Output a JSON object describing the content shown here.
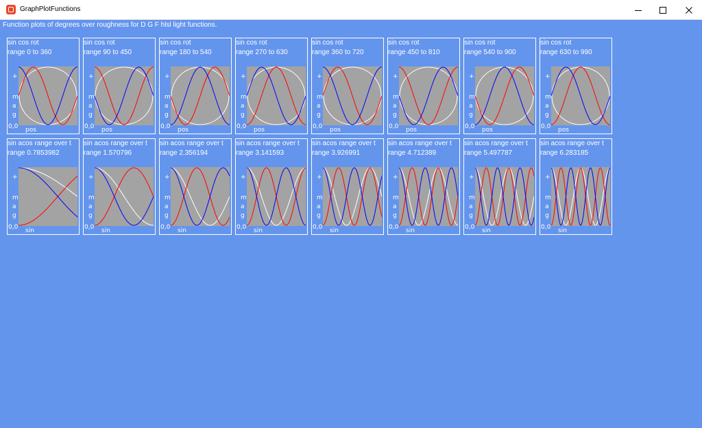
{
  "window": {
    "title": "GraphPlotFunctions",
    "controls": {
      "minimize": "minimize-icon",
      "maximize": "maximize-icon",
      "close": "close-icon"
    }
  },
  "description": "Function plots of degrees over roughness for D G F  hlsl light functions.",
  "colors": {
    "background": "#6495ED",
    "plot_bg": "#A3A3A3",
    "sin": "#FF0000",
    "cos": "#0000FF",
    "circle": "#FFFFFF"
  },
  "rows": [
    {
      "kind": "sincos",
      "panels": [
        {
          "title": "sin cos rot",
          "subtitle": "range 0 to 360",
          "start_deg": 0,
          "end_deg": 360,
          "ylabel": "+",
          "yaxis": "mag",
          "origin": "0,0",
          "xlabel": "pos"
        },
        {
          "title": "sin cos rot",
          "subtitle": "range 90 to 450",
          "start_deg": 90,
          "end_deg": 450,
          "ylabel": "+",
          "yaxis": "mag",
          "origin": "0,0",
          "xlabel": "pos"
        },
        {
          "title": "sin cos rot",
          "subtitle": "range 180 to 540",
          "start_deg": 180,
          "end_deg": 540,
          "ylabel": "+",
          "yaxis": "mag",
          "origin": "0,0",
          "xlabel": "pos"
        },
        {
          "title": "sin cos rot",
          "subtitle": "range 270 to 630",
          "start_deg": 270,
          "end_deg": 630,
          "ylabel": "+",
          "yaxis": "mag",
          "origin": "0,0",
          "xlabel": "pos"
        },
        {
          "title": "sin cos rot",
          "subtitle": "range 360 to 720",
          "start_deg": 360,
          "end_deg": 720,
          "ylabel": "+",
          "yaxis": "mag",
          "origin": "0,0",
          "xlabel": "pos"
        },
        {
          "title": "sin cos rot",
          "subtitle": "range 450 to 810",
          "start_deg": 450,
          "end_deg": 810,
          "ylabel": "+",
          "yaxis": "mag",
          "origin": "0,0",
          "xlabel": "pos"
        },
        {
          "title": "sin cos rot",
          "subtitle": "range 540 to 900",
          "start_deg": 540,
          "end_deg": 900,
          "ylabel": "+",
          "yaxis": "mag",
          "origin": "0,0",
          "xlabel": "pos"
        },
        {
          "title": "sin cos rot",
          "subtitle": "range 630 to 990",
          "start_deg": 630,
          "end_deg": 990,
          "ylabel": "+",
          "yaxis": "mag",
          "origin": "0,0",
          "xlabel": "pos"
        }
      ]
    },
    {
      "kind": "sinacos",
      "panels": [
        {
          "title": "sin acos range over t",
          "subtitle": "range 0.7853982",
          "range": 0.7853982,
          "ylabel": "+",
          "yaxis": "mag",
          "origin": "0,0",
          "xlabel": "sin"
        },
        {
          "title": "sin acos range over t",
          "subtitle": "range 1.570796",
          "range": 1.570796,
          "ylabel": "+",
          "yaxis": "mag",
          "origin": "0,0",
          "xlabel": "sin"
        },
        {
          "title": "sin acos range over t",
          "subtitle": "range 2.356194",
          "range": 2.356194,
          "ylabel": "+",
          "yaxis": "mag",
          "origin": "0,0",
          "xlabel": "sin"
        },
        {
          "title": "sin acos range over t",
          "subtitle": "range 3.141593",
          "range": 3.141593,
          "ylabel": "+",
          "yaxis": "mag",
          "origin": "0,0",
          "xlabel": "sin"
        },
        {
          "title": "sin acos range over t",
          "subtitle": "range 3.926991",
          "range": 3.926991,
          "ylabel": "+",
          "yaxis": "mag",
          "origin": "0,0",
          "xlabel": "sin"
        },
        {
          "title": "sin acos range over t",
          "subtitle": "range 4.712389",
          "range": 4.712389,
          "ylabel": "+",
          "yaxis": "mag",
          "origin": "0,0",
          "xlabel": "sin"
        },
        {
          "title": "sin acos range over t",
          "subtitle": "range 5.497787",
          "range": 5.497787,
          "ylabel": "+",
          "yaxis": "mag",
          "origin": "0,0",
          "xlabel": "sin"
        },
        {
          "title": "sin acos range over t",
          "subtitle": "range 6.283185",
          "range": 6.283185,
          "ylabel": "+",
          "yaxis": "mag",
          "origin": "0,0",
          "xlabel": "sin"
        }
      ]
    }
  ]
}
